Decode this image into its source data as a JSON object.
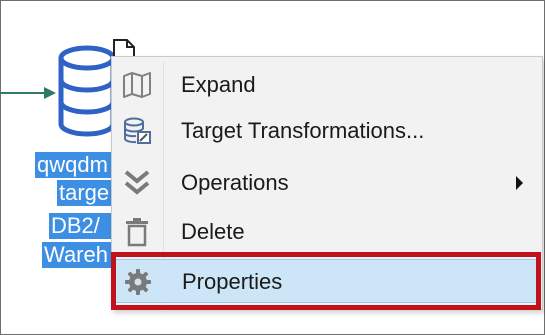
{
  "node": {
    "label_lines": [
      "qwqdm",
      "targe",
      "DB2/",
      "Wareh"
    ]
  },
  "icons": {
    "connector_arrow": "arrow-right-icon",
    "database": "database-icon",
    "document": "document-icon"
  },
  "context_menu": {
    "items": [
      {
        "label": "Expand",
        "icon": "map-icon",
        "has_submenu": false
      },
      {
        "label": "Target Transformations...",
        "icon": "database-edit-icon",
        "has_submenu": false
      },
      {
        "label": "Operations",
        "icon": "chevron-double-down-icon",
        "has_submenu": true
      },
      {
        "label": "Delete",
        "icon": "trash-icon",
        "has_submenu": false
      },
      {
        "label": "Properties",
        "icon": "gear-icon",
        "has_submenu": false,
        "highlighted": true
      }
    ]
  },
  "colors": {
    "selection": "#3d8fe3",
    "highlight_border": "#c0121b",
    "hover_fill": "#cde6f7",
    "connector": "#2f7a63"
  }
}
